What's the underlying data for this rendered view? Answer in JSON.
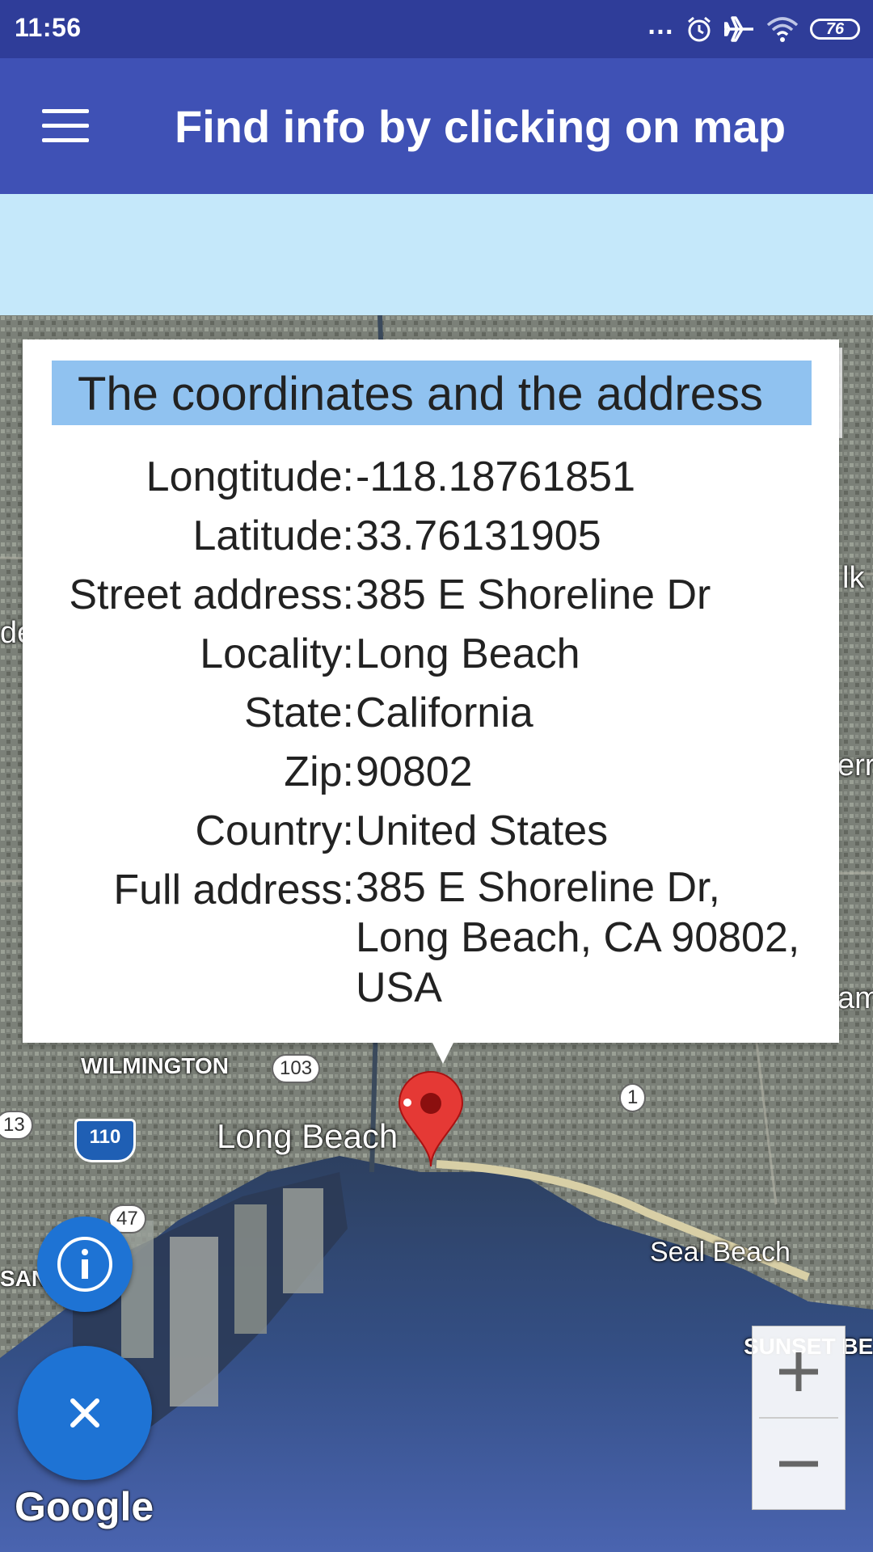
{
  "status_bar": {
    "time": "11:56",
    "battery": "76",
    "icons": [
      "more-dots-icon",
      "alarm-icon",
      "airplane-icon",
      "wifi-icon",
      "battery-icon"
    ]
  },
  "app_bar": {
    "title": "Find info by clicking on map",
    "menu_icon": "hamburger-menu-icon"
  },
  "popup": {
    "heading": "The coordinates and the address",
    "rows": [
      {
        "label": "Longtitude:",
        "value": "-118.18761851"
      },
      {
        "label": "Latitude:",
        "value": "33.76131905"
      },
      {
        "label": "Street address:",
        "value": "385 E Shoreline Dr"
      },
      {
        "label": "Locality:",
        "value": "Long Beach"
      },
      {
        "label": "State:",
        "value": "California"
      },
      {
        "label": "Zip:",
        "value": "90802"
      },
      {
        "label": "Country:",
        "value": "United States"
      },
      {
        "label": "Full address:",
        "value": "385 E Shoreline Dr, Long Beach, CA 90802, USA"
      }
    ]
  },
  "map": {
    "labels": {
      "wilmington": "WILMINGTON",
      "long_beach": "Long Beach",
      "seal_beach": "Seal Beach",
      "sunset_beach": "SUNSET BEA",
      "san": "SAN",
      "edge_lk": "lk",
      "edge_de": "de",
      "edge_erri": "erri",
      "edge_am": "am"
    },
    "shields": {
      "r103": "103",
      "r1": "1",
      "r13": "13",
      "r47": "47",
      "i110": "110"
    },
    "marker_icon": "red-map-pin-icon",
    "attribution": "Google"
  },
  "controls": {
    "my_location_icon": "my-location-crosshair-icon",
    "zoom_in": "+",
    "zoom_out": "−",
    "info_icon": "info-icon",
    "close_label": "×"
  }
}
